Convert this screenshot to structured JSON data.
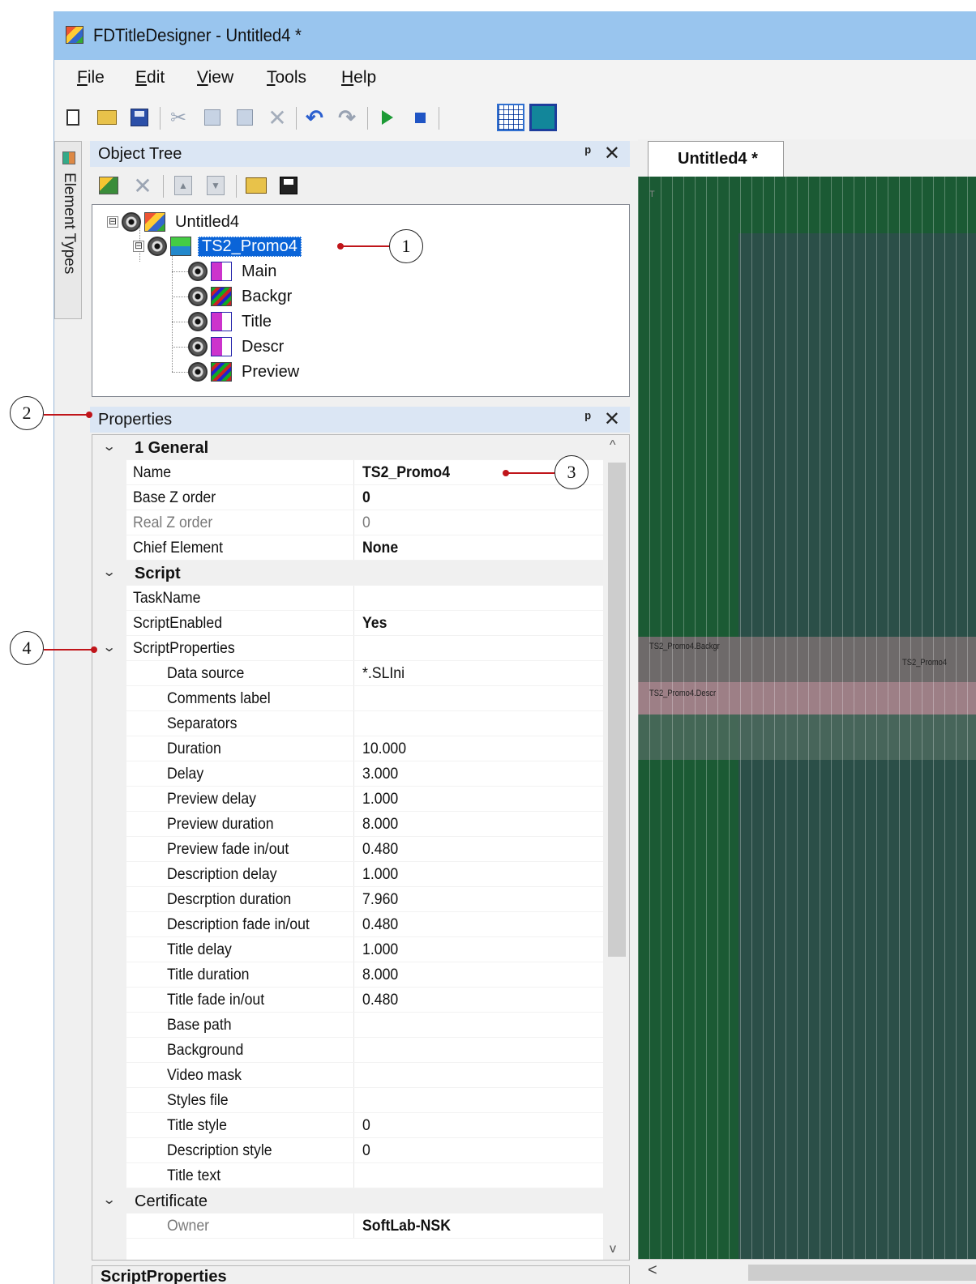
{
  "window": {
    "title": "FDTitleDesigner - Untitled4 *"
  },
  "menu": [
    {
      "label": "File",
      "u": "F",
      "rest": "ile"
    },
    {
      "label": "Edit",
      "u": "E",
      "rest": "dit"
    },
    {
      "label": "View",
      "u": "V",
      "rest": "iew"
    },
    {
      "label": "Tools",
      "u": "T",
      "rest": "ools"
    },
    {
      "label": "Help",
      "u": "H",
      "rest": "elp"
    }
  ],
  "toolbar_icons": [
    "new-icon",
    "open-icon",
    "save-icon",
    "cut-icon",
    "copy-icon",
    "paste-icon",
    "delete-icon",
    "undo-icon",
    "redo-icon",
    "play-icon",
    "stop-icon",
    "grid-icon",
    "safe-frame-icon"
  ],
  "side_tab": {
    "label": "Element Types"
  },
  "object_tree": {
    "title": "Object Tree",
    "pin": "ᵖ",
    "close": "✕",
    "nodes": [
      {
        "label": "Untitled4",
        "icon": "project-icon",
        "expander": "⊟"
      },
      {
        "label": "TS2_Promo4",
        "icon": "scene-icon",
        "expander": "⊟",
        "selected": true
      },
      {
        "label": "Main",
        "icon": "text-element-icon"
      },
      {
        "label": "Backgr",
        "icon": "video-element-icon"
      },
      {
        "label": "Title",
        "icon": "text-element-icon"
      },
      {
        "label": "Descr",
        "icon": "text-element-icon"
      },
      {
        "label": "Preview",
        "icon": "video-element-icon"
      }
    ]
  },
  "properties": {
    "title": "Properties",
    "pin": "ᵖ",
    "close": "✕",
    "chevron": "⌄",
    "rows": [
      {
        "kind": "cat",
        "label": "1 General"
      },
      {
        "kind": "prop",
        "name": "Name",
        "value": "TS2_Promo4",
        "bold": true
      },
      {
        "kind": "prop",
        "name": "Base Z order",
        "value": "0",
        "bold": true
      },
      {
        "kind": "prop",
        "name": "Real Z order",
        "value": "0",
        "dim": true
      },
      {
        "kind": "prop",
        "name": "Chief Element",
        "value": "None",
        "bold": true
      },
      {
        "kind": "cat",
        "label": "Script"
      },
      {
        "kind": "prop",
        "name": "TaskName",
        "value": ""
      },
      {
        "kind": "prop",
        "name": "ScriptEnabled",
        "value": "Yes",
        "bold": true
      },
      {
        "kind": "sub",
        "name": "ScriptProperties"
      },
      {
        "kind": "prop2",
        "name": "Data source",
        "value": "*.SLIni"
      },
      {
        "kind": "prop2",
        "name": "Comments label",
        "value": ""
      },
      {
        "kind": "prop2",
        "name": "Separators",
        "value": ""
      },
      {
        "kind": "prop2",
        "name": "Duration",
        "value": "10.000"
      },
      {
        "kind": "prop2",
        "name": "Delay",
        "value": "3.000"
      },
      {
        "kind": "prop2",
        "name": "Preview delay",
        "value": "1.000"
      },
      {
        "kind": "prop2",
        "name": "Preview duration",
        "value": "8.000"
      },
      {
        "kind": "prop2",
        "name": "Preview fade in/out",
        "value": "0.480"
      },
      {
        "kind": "prop2",
        "name": "Description delay",
        "value": "1.000"
      },
      {
        "kind": "prop2",
        "name": "Descrption duration",
        "value": "7.960"
      },
      {
        "kind": "prop2",
        "name": "Description fade in/out",
        "value": "0.480"
      },
      {
        "kind": "prop2",
        "name": "Title delay",
        "value": "1.000"
      },
      {
        "kind": "prop2",
        "name": "Title duration",
        "value": "8.000"
      },
      {
        "kind": "prop2",
        "name": "Title fade in/out",
        "value": "0.480"
      },
      {
        "kind": "prop2",
        "name": "Base path",
        "value": ""
      },
      {
        "kind": "prop2",
        "name": "Background",
        "value": ""
      },
      {
        "kind": "prop2",
        "name": "Video mask",
        "value": ""
      },
      {
        "kind": "prop2",
        "name": "Styles file",
        "value": ""
      },
      {
        "kind": "prop2",
        "name": "Title style",
        "value": "0"
      },
      {
        "kind": "prop2",
        "name": "Description style",
        "value": "0"
      },
      {
        "kind": "prop2",
        "name": "Title text",
        "value": ""
      },
      {
        "kind": "cat-plain",
        "label": "Certificate"
      },
      {
        "kind": "prop2dim",
        "name": "Owner",
        "value": "SoftLab-NSK",
        "bold": true
      }
    ],
    "description_title": "ScriptProperties"
  },
  "canvas": {
    "tab_label": "Untitled4 *",
    "labels": {
      "backgr": "TS2_Promo4.Backgr",
      "promo": "TS2_Promo4",
      "descr": "TS2_Promo4.Descr"
    },
    "tick": "T",
    "colors": {
      "outer": "#1b5a34",
      "inner": "#2b4f48",
      "band1": "#6e6a6a",
      "band2": "#9d7f86"
    }
  },
  "scroll": {
    "up": "^",
    "down": "v",
    "left": "<"
  },
  "callouts": [
    "1",
    "2",
    "3",
    "4"
  ]
}
